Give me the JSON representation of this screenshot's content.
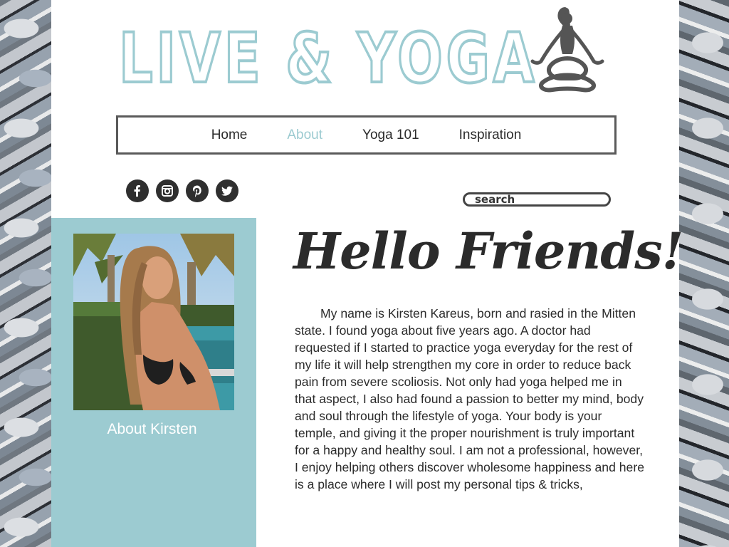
{
  "site": {
    "brand_title": "LIVE & YOGA",
    "logo_icon": "meditating-woman-icon"
  },
  "nav": {
    "items": [
      {
        "label": "Home",
        "active": false
      },
      {
        "label": "About",
        "active": true
      },
      {
        "label": "Yoga 101",
        "active": false
      },
      {
        "label": "Inspiration",
        "active": false
      }
    ]
  },
  "social": {
    "icons": [
      "facebook-icon",
      "instagram-icon",
      "pinterest-icon",
      "twitter-icon"
    ]
  },
  "search": {
    "placeholder": "search"
  },
  "sidebar": {
    "photo_icon": "profile-photo",
    "caption": "About Kirsten"
  },
  "main": {
    "headline": "Hello Friends!",
    "body": "My name is Kirsten Kareus, born and rasied in the Mitten state. I found yoga about five years ago. A doctor had requested if I started to practice yoga everyday for the rest of my life it will help strengthen my core in order to reduce back pain from severe scoliosis. Not only had yoga helped me in that aspect, I also had found a passion to better my mind, body and soul through the lifestyle of yoga. Your body is your temple, and giving it the proper nourishment is truly important for a happy and healthy soul. I am not a professional, however, I enjoy helping others discover wholesome happiness and here is a place where I will post my personal tips & tricks,"
  },
  "colors": {
    "accent": "#9ccbd1",
    "text": "#2b2b2b",
    "border": "#5a5a5a"
  }
}
